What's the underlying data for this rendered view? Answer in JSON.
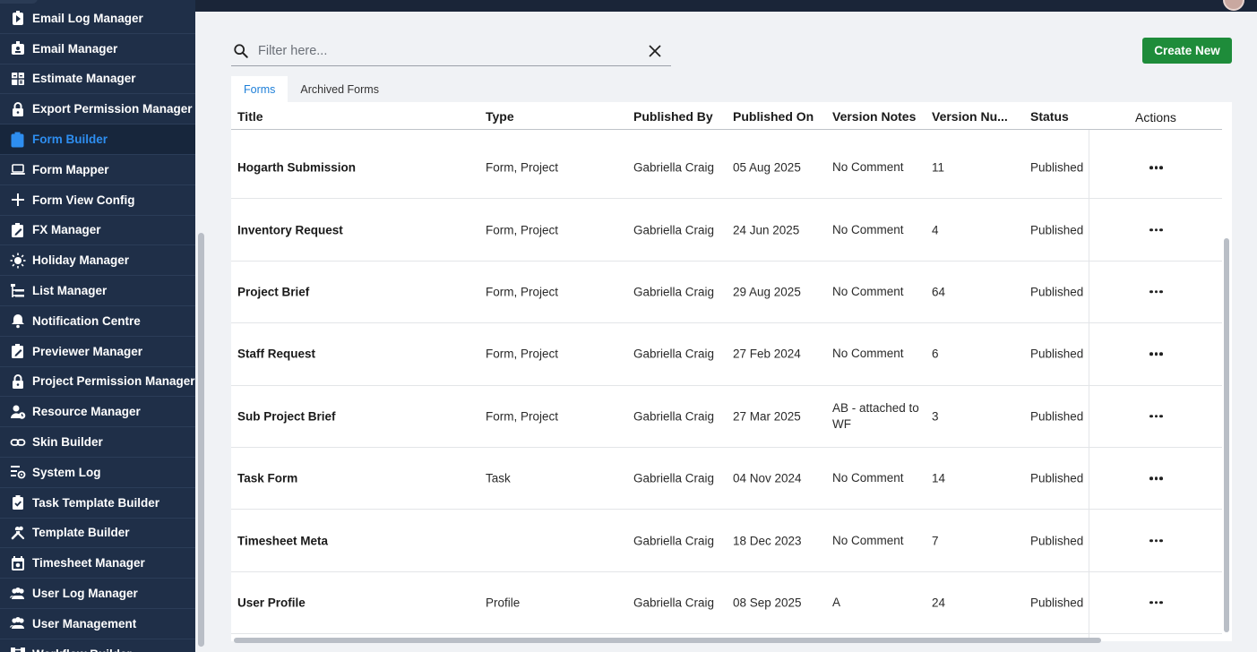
{
  "sidebar": {
    "items": [
      {
        "label": "Email Log Manager",
        "icon": "play-badge-icon"
      },
      {
        "label": "Email Manager",
        "icon": "badge-icon"
      },
      {
        "label": "Estimate Manager",
        "icon": "calculator-icon"
      },
      {
        "label": "Export Permission Manager",
        "icon": "lock-icon"
      },
      {
        "label": "Form Builder",
        "icon": "edit-clipboard-icon",
        "active": true
      },
      {
        "label": "Form Mapper",
        "icon": "laptop-icon"
      },
      {
        "label": "Form View Config",
        "icon": "plus-icon"
      },
      {
        "label": "FX Manager",
        "icon": "edit-clipboard-icon"
      },
      {
        "label": "Holiday Manager",
        "icon": "sun-icon"
      },
      {
        "label": "List Manager",
        "icon": "tree-list-icon"
      },
      {
        "label": "Notification Centre",
        "icon": "bell-icon"
      },
      {
        "label": "Previewer Manager",
        "icon": "edit-clipboard-icon"
      },
      {
        "label": "Project Permission Manager",
        "icon": "lock-icon"
      },
      {
        "label": "Resource Manager",
        "icon": "user-clock-icon"
      },
      {
        "label": "Skin Builder",
        "icon": "link-icon"
      },
      {
        "label": "System Log",
        "icon": "list-gear-icon"
      },
      {
        "label": "Task Template Builder",
        "icon": "clipboard-check-icon"
      },
      {
        "label": "Template Builder",
        "icon": "tools-icon"
      },
      {
        "label": "Timesheet Manager",
        "icon": "calendar-icon"
      },
      {
        "label": "User Log Manager",
        "icon": "users-icon"
      },
      {
        "label": "User Management",
        "icon": "users-icon"
      },
      {
        "label": "Workflow Builder",
        "icon": "workflow-icon"
      }
    ]
  },
  "search": {
    "placeholder": "Filter here...",
    "value": ""
  },
  "toolbar": {
    "create_label": "Create New"
  },
  "tabs": [
    {
      "label": "Forms",
      "active": true
    },
    {
      "label": "Archived Forms",
      "active": false
    }
  ],
  "table": {
    "columns": [
      "Title",
      "Type",
      "Published By",
      "Published On",
      "Version Notes",
      "Version Nu...",
      "Status",
      "Actions"
    ],
    "rows": [
      {
        "title": "Hogarth Submission",
        "type": "Form, Project",
        "by": "Gabriella Craig",
        "on": "05 Aug 2025",
        "notes": "No Comment",
        "version": "11",
        "status": "Published"
      },
      {
        "title": "Inventory Request",
        "type": "Form, Project",
        "by": "Gabriella Craig",
        "on": "24 Jun 2025",
        "notes": "No Comment",
        "version": "4",
        "status": "Published"
      },
      {
        "title": "Project Brief",
        "type": "Form, Project",
        "by": "Gabriella Craig",
        "on": "29 Aug 2025",
        "notes": "No Comment",
        "version": "64",
        "status": "Published"
      },
      {
        "title": "Staff Request",
        "type": "Form, Project",
        "by": "Gabriella Craig",
        "on": "27 Feb 2024",
        "notes": "No Comment",
        "version": "6",
        "status": "Published"
      },
      {
        "title": "Sub Project Brief",
        "type": "Form, Project",
        "by": "Gabriella Craig",
        "on": "27 Mar 2025",
        "notes": "AB - attached to WF",
        "version": "3",
        "status": "Published"
      },
      {
        "title": "Task Form",
        "type": "Task",
        "by": "Gabriella Craig",
        "on": "04 Nov 2024",
        "notes": "No Comment",
        "version": "14",
        "status": "Published"
      },
      {
        "title": "Timesheet Meta",
        "type": "",
        "by": "Gabriella Craig",
        "on": "18 Dec 2023",
        "notes": "No Comment",
        "version": "7",
        "status": "Published"
      },
      {
        "title": "User Profile",
        "type": "Profile",
        "by": "Gabriella Craig",
        "on": "08 Sep 2025",
        "notes": "A",
        "version": "24",
        "status": "Published"
      }
    ]
  },
  "colors": {
    "sidebar_bg": "#1f2f48",
    "active_text": "#2e8ef0",
    "create_button": "#1e8c3a",
    "tab_active": "#1e7fd8"
  }
}
